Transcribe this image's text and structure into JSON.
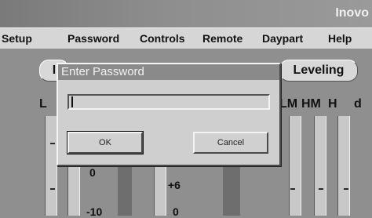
{
  "window": {
    "title": "Inovo"
  },
  "menubar": {
    "items": [
      "Setup",
      "Password",
      "Controls",
      "Remote",
      "Daypart",
      "Help"
    ]
  },
  "main": {
    "tab_left": "I",
    "tab_leveling": "Leveling",
    "labels": {
      "l": "L",
      "lm": "LM",
      "hm": "HM",
      "h": "H",
      "d": "d"
    },
    "scale": {
      "zero": "0",
      "minus10": "-10",
      "plus6": "+6",
      "zero_b": "0"
    }
  },
  "dialog": {
    "title": "Enter Password",
    "password_value": "",
    "ok_label": "OK",
    "cancel_label": "Cancel"
  }
}
